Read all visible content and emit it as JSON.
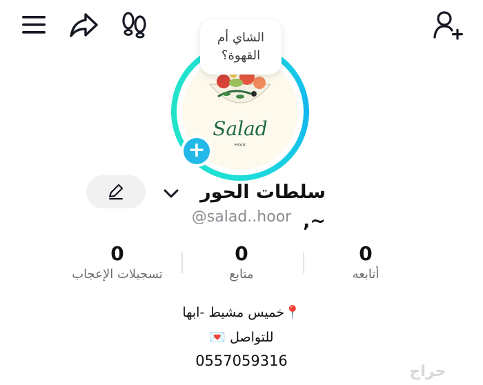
{
  "top_bar": {
    "icons": [
      "menu-icon",
      "share-icon",
      "footsteps-icon",
      "add-user-icon"
    ]
  },
  "bubble": {
    "line1": "الشاي أم",
    "line2": "القهوة؟"
  },
  "avatar": {
    "logo_text": "Salad",
    "logo_sub": "Hoor",
    "ring_color": "#1fe0d8"
  },
  "profile": {
    "display_name": "سلطات الحور ~,",
    "username": "@salad..hoor"
  },
  "stats": {
    "likes": {
      "value": "0",
      "label": "تسجيلات الإعجاب"
    },
    "following": {
      "value": "0",
      "label": "متابع"
    },
    "followers": {
      "value": "0",
      "label": "أتابعه"
    }
  },
  "bio": {
    "line1": "📍خميس مشيط -ابها",
    "line2": "للتواصل 💌",
    "line3": "0557059316"
  },
  "watermark": "حراج",
  "colors": {
    "accent": "#22b8e8",
    "ring": "#1fe0d8",
    "muted_text": "#8a8b91"
  }
}
